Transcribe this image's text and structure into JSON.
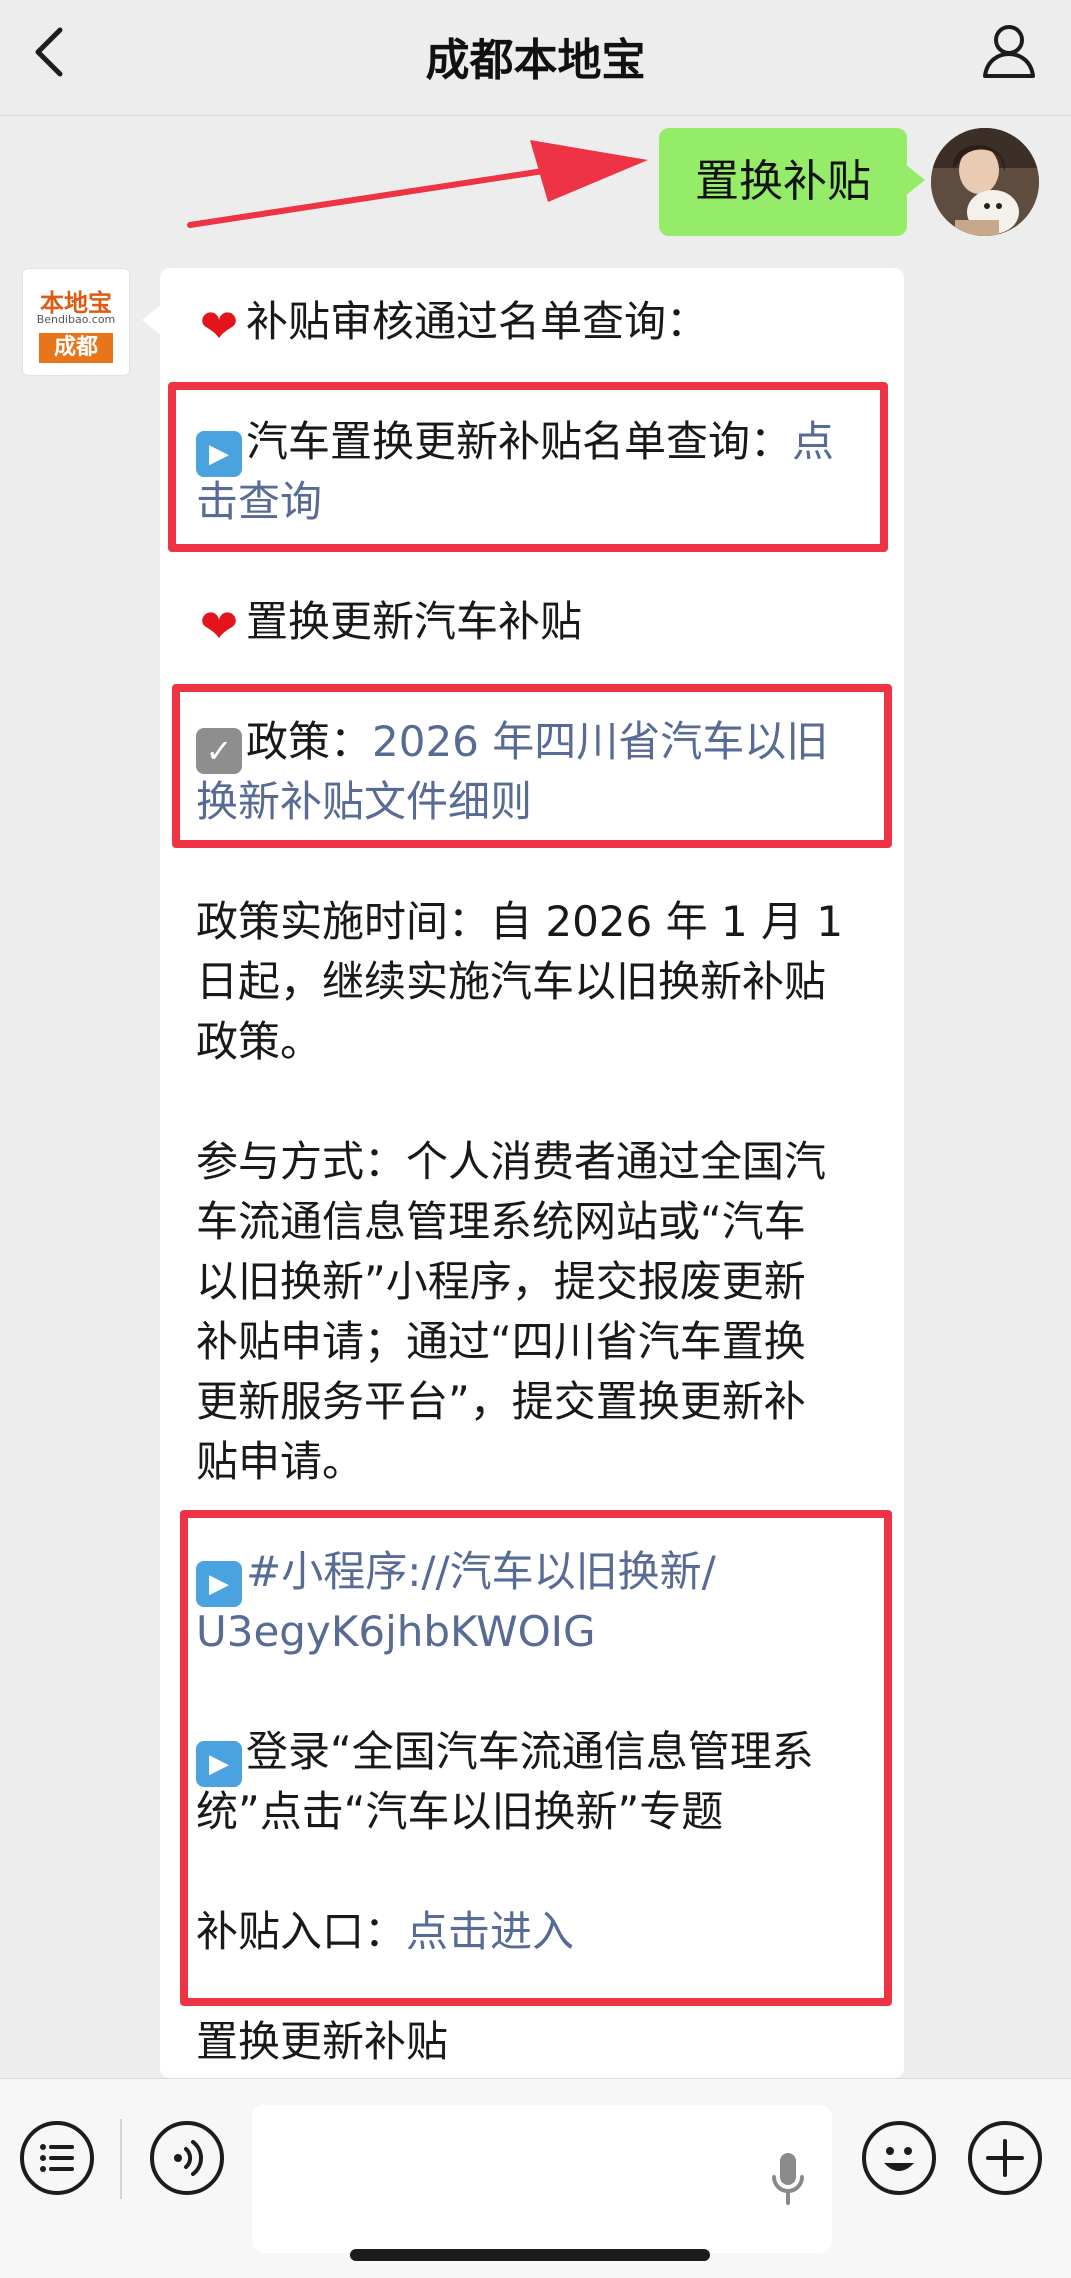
{
  "header": {
    "title": "成都本地宝"
  },
  "chat": {
    "user_message": "置换补贴",
    "bot_logo": {
      "top": "本地宝",
      "site": "Bendibao.com",
      "city": "成都"
    },
    "lines": {
      "l1": "补贴审核通过名单查询：",
      "l2a": "汽车置换更新补贴名单查询：",
      "l2b": "点",
      "l3": "击查询",
      "l4": "置换更新汽车补贴",
      "l5a": "政策：",
      "l5b": "2026 年四川省汽车以旧",
      "l6": "换新补贴文件细则",
      "l7": "政策实施时间：自 2026 年 1 月 1",
      "l8": "日起，继续实施汽车以旧换新补贴",
      "l9": "政策。",
      "l10": "参与方式：个人消费者通过全国汽",
      "l11": "车流通信息管理系统网站或“汽车",
      "l12": "以旧换新”小程序，提交报废更新",
      "l13": "补贴申请；通过“四川省汽车置换",
      "l14": "更新服务平台”，提交置换更新补",
      "l15": "贴申请。",
      "l16": "#小程序://汽车以旧换新/",
      "l17": "U3egyK6jhbKWOIG",
      "l18": "登录“全国汽车流通信息管理系",
      "l19": "统”点击“汽车以旧换新”专题",
      "l20a": "补贴入口：",
      "l20b": "点击进入",
      "l21": "置换更新补贴"
    }
  },
  "colors": {
    "user_bubble": "#95ec69",
    "link": "#576b95",
    "highlight_box": "#ee3344",
    "background": "#ededed"
  },
  "icons": {
    "back": "chevron-left-icon",
    "profile": "user-icon",
    "menu": "list-icon",
    "voice": "voice-icon",
    "mic": "microphone-icon",
    "emoji": "emoji-icon",
    "add": "plus-icon"
  }
}
